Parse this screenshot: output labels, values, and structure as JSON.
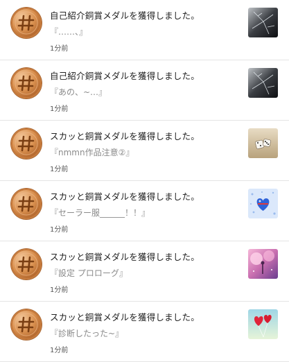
{
  "notifications": [
    {
      "title": "自己紹介銅賞メダルを獲得しました。",
      "work": "『……、』",
      "time": "1分前",
      "thumb_icon": "cracked-phone-icon"
    },
    {
      "title": "自己紹介銅賞メダルを獲得しました。",
      "work": "『あの、~…』",
      "time": "1分前",
      "thumb_icon": "cracked-phone-icon"
    },
    {
      "title": "スカッと銅賞メダルを獲得しました。",
      "work": "『nmmn作品注意②』",
      "time": "1分前",
      "thumb_icon": "dice-icon"
    },
    {
      "title": "スカッと銅賞メダルを獲得しました。",
      "work": "『セーラー服______！！』",
      "time": "1分前",
      "thumb_icon": "blue-heart-icon"
    },
    {
      "title": "スカッと銅賞メダルを獲得しました。",
      "work": "『設定 プロローグ』",
      "time": "1分前",
      "thumb_icon": "pink-tree-icon"
    },
    {
      "title": "スカッと銅賞メダルを獲得しました。",
      "work": "『診断したった~』",
      "time": "1分前",
      "thumb_icon": "heart-balloons-icon"
    }
  ],
  "colors": {
    "medal_bronze": "#c67a3c",
    "divider": "#e4e4e4",
    "title_text": "#222222",
    "quote_text": "#8a8a8a"
  }
}
